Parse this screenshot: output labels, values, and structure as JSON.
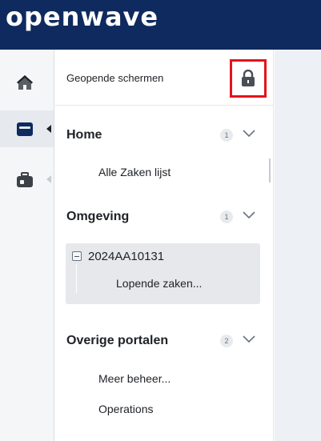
{
  "header": {
    "logo_text": "openwave",
    "background": "#0e2a5e"
  },
  "rail": {
    "items": [
      {
        "icon": "home-icon",
        "active": false
      },
      {
        "icon": "folder-icon",
        "active": true
      },
      {
        "icon": "briefcase-icon",
        "active": false
      }
    ]
  },
  "panel": {
    "title": "Geopende schermen",
    "lock_icon": "lock-icon",
    "lock_highlight_color": "#e3141b",
    "sections": [
      {
        "title": "Home",
        "count": "1",
        "items": [
          "Alle Zaken lijst"
        ]
      },
      {
        "title": "Omgeving",
        "count": "1",
        "case": {
          "id": "2024AA10131",
          "sub": "Lopende zaken..."
        }
      },
      {
        "title": "Overige portalen",
        "count": "2",
        "items": [
          "Meer beheer...",
          "Operations"
        ]
      }
    ]
  }
}
